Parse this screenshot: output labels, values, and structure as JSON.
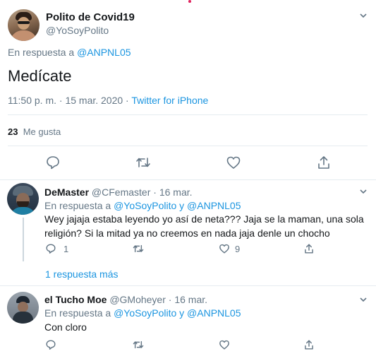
{
  "colors": {
    "accent": "#1b95e0",
    "secondary_text": "#657786",
    "divider": "#e6ecf0"
  },
  "main_tweet": {
    "author_name": "Polito de Covid19",
    "handle": "@YoSoyPolito",
    "reply_prefix": "En respuesta a ",
    "reply_to": "@ANPNL05",
    "text": "Medícate",
    "timestamp": "11:50 p. m. · 15 mar. 2020 · ",
    "source": "Twitter for iPhone",
    "like_count": "23",
    "like_label": "Me gusta",
    "actions": [
      "reply-icon",
      "retweet-icon",
      "like-icon",
      "share-icon"
    ]
  },
  "replies": [
    {
      "author_name": "DeMaster",
      "handle": "@CFemaster",
      "date": "· 16 mar.",
      "reply_prefix": "En respuesta a ",
      "reply_to": "@YoSoyPolito y @ANPNL05",
      "text": "Wey jajaja estaba leyendo yo así de neta??? Jaja se la maman, una sola religión? Si la mitad ya no creemos en nada jaja denle un chocho",
      "reply_count": "1",
      "retweet_count": "",
      "like_count": "9"
    },
    {
      "author_name": "el Tucho Moe",
      "handle": "@GMoheyer",
      "date": "· 16 mar.",
      "reply_prefix": "En respuesta a ",
      "reply_to": "@YoSoyPolito y @ANPNL05",
      "text": "Con cloro",
      "reply_count": "",
      "retweet_count": "",
      "like_count": ""
    }
  ],
  "more_replies_link": "1 respuesta más"
}
